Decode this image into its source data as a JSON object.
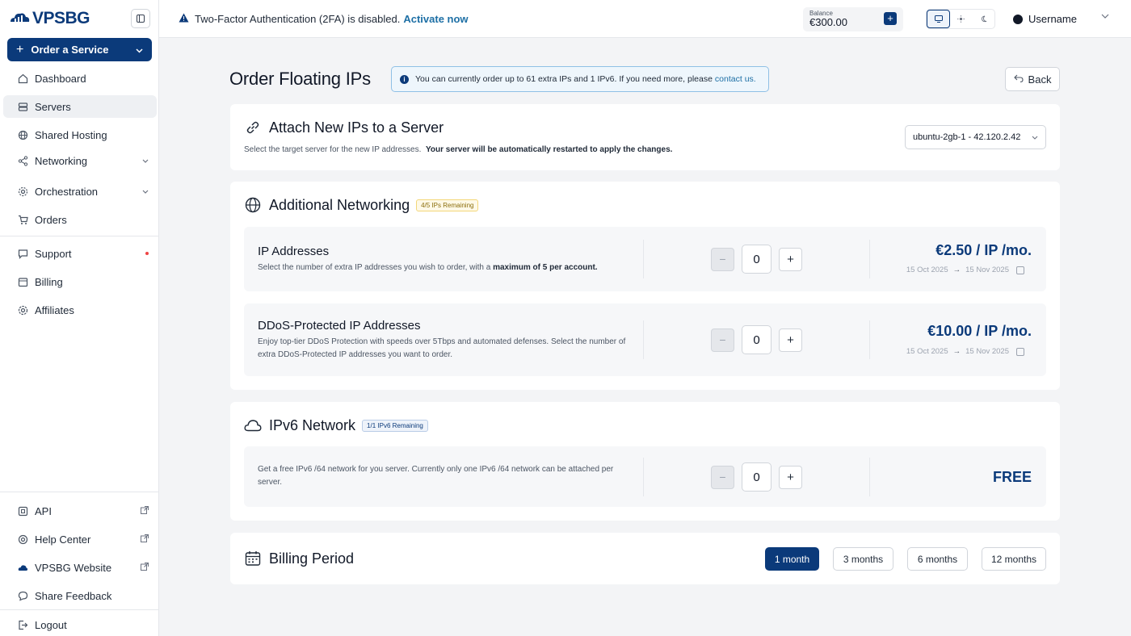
{
  "brand": {
    "name": "VPSBG"
  },
  "sidebar": {
    "order_button": "Order a Service",
    "items": [
      {
        "label": "Dashboard",
        "icon": "home-icon"
      },
      {
        "label": "Servers",
        "icon": "server-icon"
      },
      {
        "label": "Shared Hosting",
        "icon": "globe-icon"
      },
      {
        "label": "Networking",
        "icon": "share-icon"
      },
      {
        "label": "Orchestration",
        "icon": "cog-icon"
      },
      {
        "label": "Orders",
        "icon": "cart-icon"
      },
      {
        "label": "Support",
        "icon": "chat-icon"
      },
      {
        "label": "Billing",
        "icon": "wallet-icon"
      },
      {
        "label": "Affiliates",
        "icon": "users-icon"
      }
    ],
    "bottom_items": [
      {
        "label": "API",
        "icon": "code-icon"
      },
      {
        "label": "Help Center",
        "icon": "help-icon"
      },
      {
        "label": "VPSBG Website",
        "icon": "cloud-icon"
      },
      {
        "label": "Share Feedback",
        "icon": "message-icon"
      },
      {
        "label": "Logout",
        "icon": "logout-icon"
      }
    ]
  },
  "topbar": {
    "alert_text": "Two-Factor Authentication (2FA) is disabled.",
    "alert_link": "Activate now",
    "balance_label": "Balance",
    "balance_value": "€300.00",
    "username": "Username"
  },
  "page": {
    "title": "Order Floating IPs",
    "info_text": "You can currently order up to 61 extra IPs and 1 IPv6. If you need more, please",
    "info_link": "contact us.",
    "back_label": "Back"
  },
  "attach": {
    "title": "Attach New IPs to a Server",
    "subtitle": "Select the target server for the new IP addresses.",
    "subtitle_bold": "Your server will be automatically restarted to apply the changes.",
    "server_selected": "ubuntu-2gb-1 - 42.120.2.42"
  },
  "additional": {
    "title": "Additional Networking",
    "badge": "4/5 IPs Remaining",
    "ip": {
      "title": "IP Addresses",
      "desc": "Select the number of extra IP addresses you wish to order, with a",
      "desc_bold": "maximum of 5 per account.",
      "qty": "0",
      "price": "€2.50 / IP /mo.",
      "date_from": "15 Oct 2025",
      "date_to": "15 Nov 2025"
    },
    "ddos": {
      "title": "DDoS-Protected IP Addresses",
      "desc": "Enjoy top-tier DDoS Protection with speeds over 5Tbps and automated defenses. Select the number of extra DDoS-Protected IP addresses you want to order.",
      "qty": "0",
      "price": "€10.00 / IP /mo.",
      "date_from": "15 Oct 2025",
      "date_to": "15 Nov 2025"
    }
  },
  "ipv6": {
    "title": "IPv6 Network",
    "badge": "1/1 IPv6 Remaining",
    "desc": "Get a free IPv6 /64 network for you server. Currently only one IPv6 /64 network can be attached per server.",
    "qty": "0",
    "price": "FREE"
  },
  "billing": {
    "title": "Billing Period",
    "options": [
      "1 month",
      "3 months",
      "6 months",
      "12 months"
    ],
    "selected": "1 month"
  },
  "colors": {
    "primary": "#0b3a7a",
    "link": "#1d6fa5",
    "background": "#f3f4f6"
  }
}
